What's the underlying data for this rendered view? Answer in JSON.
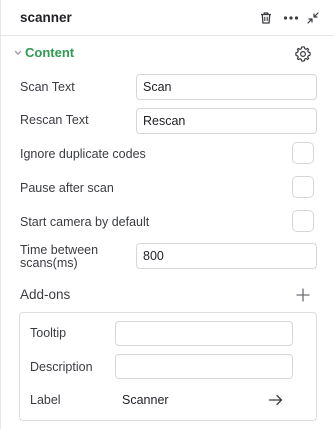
{
  "header": {
    "title": "scanner",
    "icons": [
      "trash-icon",
      "more-icon",
      "collapse-icon"
    ]
  },
  "section": {
    "title": "Content",
    "icons": [
      "chevron-down-icon",
      "gear-icon"
    ]
  },
  "fields": {
    "scan_text": {
      "label": "Scan Text",
      "value": "Scan"
    },
    "rescan_text": {
      "label": "Rescan Text",
      "value": "Rescan"
    },
    "ignore_duplicates": {
      "label": "Ignore duplicate codes",
      "checked": false
    },
    "pause_after_scan": {
      "label": "Pause after scan",
      "checked": false
    },
    "start_camera": {
      "label": "Start camera by default",
      "checked": false
    },
    "time_between": {
      "label_line1": "Time between",
      "label_line2": "scans(ms)",
      "value": "800"
    }
  },
  "addons": {
    "title": "Add-ons",
    "tooltip": {
      "label": "Tooltip",
      "value": ""
    },
    "description": {
      "label": "Description",
      "value": ""
    },
    "label": {
      "label": "Label",
      "value": "Scanner"
    }
  },
  "colors": {
    "accent": "#2e9a52",
    "border": "#d5d7db",
    "text": "#3a3c42"
  }
}
